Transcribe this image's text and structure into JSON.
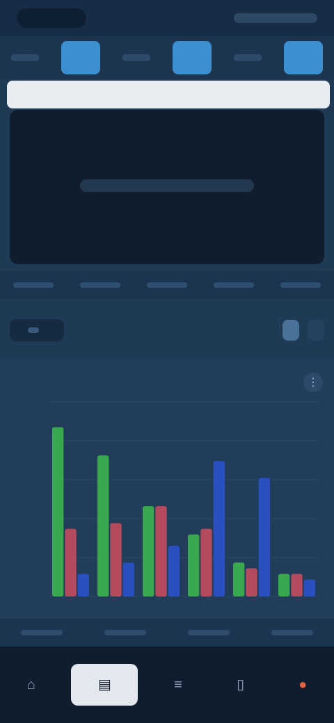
{
  "summary": {
    "cols": [
      {
        "head": "",
        "value": ""
      },
      {
        "head": "",
        "value": ""
      },
      {
        "head": "",
        "value": ""
      }
    ]
  },
  "toolbar": {
    "timeframes": [
      "",
      "",
      "",
      ""
    ],
    "right_pills": [
      "",
      ""
    ]
  },
  "chart": {
    "title": "",
    "menu_icon": "more-icon"
  },
  "nav": {
    "items": [
      {
        "icon": "home-icon",
        "glyph": "⌂",
        "label": ""
      },
      {
        "icon": "chart-icon",
        "glyph": "▤",
        "label": ""
      },
      {
        "icon": "list-icon",
        "glyph": "≡",
        "label": ""
      },
      {
        "icon": "doc-icon",
        "glyph": "▯",
        "label": ""
      },
      {
        "icon": "alert-icon",
        "glyph": "●",
        "label": ""
      }
    ]
  },
  "chart_data": {
    "type": "bar",
    "categories": [
      "",
      "",
      "",
      "",
      "",
      ""
    ],
    "series": [
      {
        "color": "#3aa84f",
        "values": [
          3,
          2.5,
          1.6,
          1.1,
          0.6,
          0.4
        ]
      },
      {
        "color": "#b34a5e",
        "values": [
          1.2,
          1.3,
          1.6,
          1.2,
          0.5,
          0.4
        ]
      },
      {
        "color": "#2a4fbf",
        "values": [
          0.4,
          0.6,
          0.9,
          2.4,
          2.1,
          0.3
        ]
      }
    ]
  }
}
